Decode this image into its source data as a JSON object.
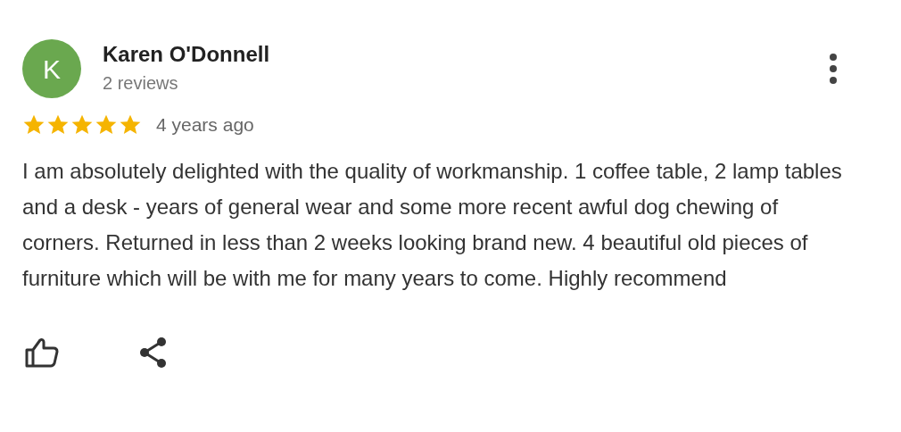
{
  "review": {
    "avatar_letter": "K",
    "name": "Karen O'Donnell",
    "review_count": "2 reviews",
    "stars": 5,
    "time": "4 years ago",
    "text": "I am absolutely delighted with the quality of workmanship. 1 coffee table, 2 lamp tables and a desk - years of general wear and some more recent awful dog chewing of corners. Returned in less than 2 weeks looking brand new. 4 beautiful old pieces of furniture which will be with me for many years to come. Highly recommend"
  }
}
